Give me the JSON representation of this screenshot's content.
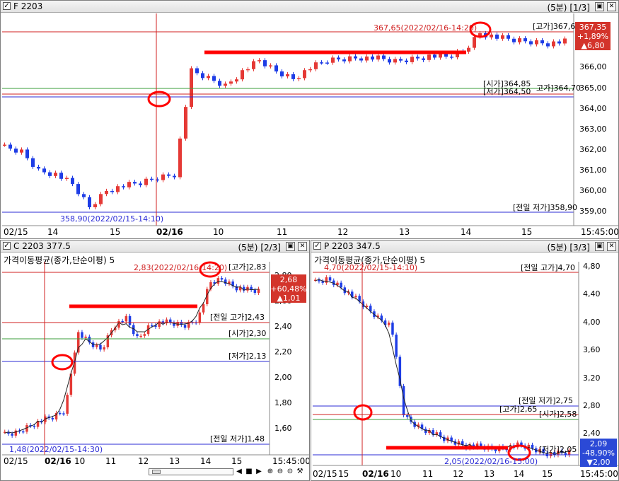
{
  "colors": {
    "up": "#e53935",
    "down": "#1e3de6",
    "highlight": "#ff0000",
    "grid": "#c8c8c8",
    "open_line": "#3a9e3a",
    "prev_line": "#2b2bd6",
    "price_box": "#d3342b"
  },
  "panel_f": {
    "symbol": "F 2203",
    "period": "(5분)",
    "page": "[1/3]",
    "y_ticks": [
      "366,00",
      "365,00",
      "364,00",
      "363,00",
      "362,00",
      "361,00",
      "360,00",
      "359,00"
    ],
    "x_labels": [
      "02/15",
      "14",
      "15",
      "02/16",
      "10",
      "11",
      "12",
      "13",
      "14",
      "15",
      "15:45:00"
    ],
    "high_annot": "367,65(2022/02/16-14:20)",
    "high_label": "[고가]367,65",
    "open_label": "[시가]364,85",
    "low_label": "[저가]364,50",
    "low2_label": "고가]364,70",
    "prev_low_label": "[전일 저가]358,90",
    "low_annot": "358,90(2022/02/15-14:10)",
    "price": {
      "value": "367,35",
      "pct": "+1,89%",
      "chg": "▲6,80"
    }
  },
  "panel_c": {
    "symbol": "C 2203 377.5",
    "period": "(5분)",
    "page": "[2/3]",
    "indicator": "가격이동평균(종가,단순이평) 5",
    "y_ticks": [
      "2,80",
      "2,60",
      "2,40",
      "2,20",
      "2,00",
      "1,80",
      "1,60"
    ],
    "x_labels": [
      "02/15",
      "02/16",
      "10",
      "11",
      "12",
      "13",
      "14",
      "15",
      "15:45:00"
    ],
    "high_annot": "2,83(2022/02/16-14:20)",
    "high_label": "[고가]2,83",
    "prev_high_label": "[전일 고가]2,43",
    "open_label": "[시가]2,30",
    "low_label": "[저가]2,13",
    "prev_low_label": "[전일 저가]1,48",
    "low_annot": "1,48(2022/02/15-14:30)",
    "price": {
      "value": "2,68",
      "pct": "+60,48%",
      "chg": "▲1,01"
    }
  },
  "panel_p": {
    "symbol": "P 2203 347.5",
    "period": "(5분)",
    "page": "[3/3]",
    "indicator": "가격이동평균(종가,단순이평) 5",
    "y_ticks": [
      "4,80",
      "4,40",
      "4,00",
      "3,60",
      "3,20",
      "2,80",
      "2,40"
    ],
    "x_labels": [
      "02/15",
      "15",
      "02/16",
      "10",
      "11",
      "12",
      "13",
      "14",
      "15",
      "15:45:00"
    ],
    "top_annot": "4,70(2022/02/15-14:10)",
    "prev_high_label": "[전일 고가]4,70",
    "prev_low_label": "[전일 저가]2,75",
    "high_label": "[고가]2,65",
    "open_label": "[시가]2,58",
    "low_label": "[저가]2,05",
    "low_annot": "2,05(2022/02/16-15:00)",
    "price": {
      "value": "2,09",
      "pct": "-48,90%",
      "chg": "▼2,00"
    }
  }
}
